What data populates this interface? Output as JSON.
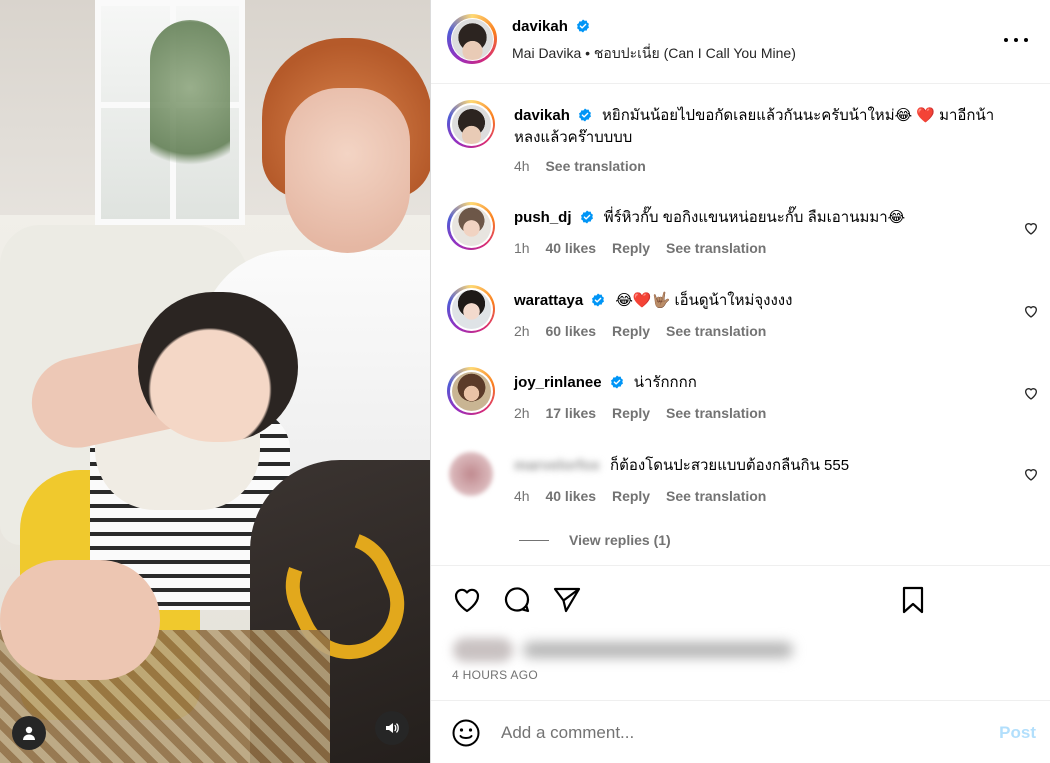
{
  "colors": {
    "accent": "#0095f6",
    "post_disabled": "#b2dffc",
    "muted": "#737373",
    "verified": "#0095f6"
  },
  "post": {
    "author": "davikah",
    "subtitle": "Mai Davika • ชอบปะเนี่ย (Can I Call You Mine)",
    "timestamp": "4 HOURS AGO"
  },
  "caption": {
    "username": "davikah",
    "text": "หยิกมันน้อยไปขอกัดเลยแล้วกันนะครับน้าใหม่😂 ❤️  มาอีกน้าหลงแล้วคร๊าบบบบ",
    "time": "4h",
    "see_translation": "See translation"
  },
  "comments": [
    {
      "username": "push_dj",
      "verified": true,
      "text": "พี่ร์หิวกั๊บ ขอกิงแขนหน่อยนะกั๊บ ลืมเอานมมา😂",
      "time": "1h",
      "likes": "40 likes",
      "reply": "Reply",
      "see_translation": "See translation"
    },
    {
      "username": "warattaya",
      "verified": true,
      "text": "😂❤️🤟🏽 เอ็นดูน้าใหม่จุงงงง",
      "time": "2h",
      "likes": "60 likes",
      "reply": "Reply",
      "see_translation": "See translation"
    },
    {
      "username": "joy_rinlanee",
      "verified": true,
      "text": "น่ารักกกก",
      "time": "2h",
      "likes": "17 likes",
      "reply": "Reply",
      "see_translation": "See translation"
    },
    {
      "username": "marvelorfox",
      "verified": false,
      "text": "ก็ต้องโดนปะสวยแบบต้องกลืนกิน 555",
      "time": "4h",
      "likes": "40 likes",
      "reply": "Reply",
      "see_translation": "See translation"
    }
  ],
  "view_replies": "View replies (1)",
  "add_comment": {
    "placeholder": "Add a comment...",
    "post_label": "Post"
  },
  "icons": {
    "more": "more-horizontal-icon",
    "like": "heart-icon",
    "comment": "speech-bubble-icon",
    "share": "paper-plane-icon",
    "save": "bookmark-icon",
    "emoji": "smiley-icon",
    "user": "user-icon",
    "mute": "speaker-icon"
  }
}
